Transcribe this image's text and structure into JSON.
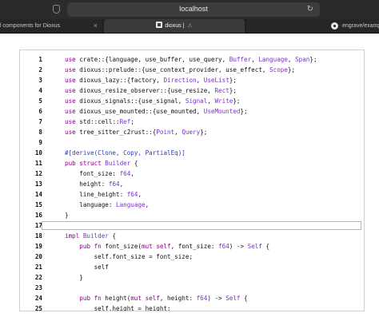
{
  "browser": {
    "url": "localhost",
    "tabs": [
      {
        "label": "l components for Dioxus",
        "close": "×"
      },
      {
        "label": "dioxus | ",
        "warning": "⚠"
      },
      {
        "label": "engrave/example"
      }
    ]
  },
  "editor": {
    "lines": [
      {
        "n": "1",
        "tokens": [
          [
            "kw",
            "use"
          ],
          [
            "",
            "crate::{language, use_buffer, use_query, "
          ],
          [
            "ty",
            "Buffer"
          ],
          [
            "",
            ", "
          ],
          [
            "ty",
            "Language"
          ],
          [
            "",
            ", "
          ],
          [
            "ty",
            "Span"
          ],
          [
            "",
            "};"
          ]
        ]
      },
      {
        "n": "2",
        "tokens": [
          [
            "kw",
            "use"
          ],
          [
            "",
            "dioxus::prelude::{use_context_provider, use_effect, "
          ],
          [
            "ty",
            "Scope"
          ],
          [
            "",
            "};"
          ]
        ]
      },
      {
        "n": "3",
        "tokens": [
          [
            "kw",
            "use"
          ],
          [
            "",
            "dioxus_lazy::{factory, "
          ],
          [
            "ty",
            "Direction"
          ],
          [
            "",
            ", "
          ],
          [
            "ty",
            "UseList"
          ],
          [
            "",
            "};"
          ]
        ]
      },
      {
        "n": "4",
        "tokens": [
          [
            "kw",
            "use"
          ],
          [
            "",
            "dioxus_resize_observer::{use_resize, "
          ],
          [
            "ty",
            "Rect"
          ],
          [
            "",
            "};"
          ]
        ]
      },
      {
        "n": "5",
        "tokens": [
          [
            "kw",
            "use"
          ],
          [
            "",
            "dioxus_signals::{use_signal, "
          ],
          [
            "ty",
            "Signal"
          ],
          [
            "",
            ", "
          ],
          [
            "ty",
            "Write"
          ],
          [
            "",
            "};"
          ]
        ]
      },
      {
        "n": "6",
        "tokens": [
          [
            "kw",
            "use"
          ],
          [
            "",
            "dioxus_use_mounted::{use_mounted, "
          ],
          [
            "ty",
            "UseMounted"
          ],
          [
            "",
            "};"
          ]
        ]
      },
      {
        "n": "7",
        "tokens": [
          [
            "kw",
            "use"
          ],
          [
            "",
            "std::cell::"
          ],
          [
            "ty",
            "Ref"
          ],
          [
            "",
            ";"
          ]
        ]
      },
      {
        "n": "8",
        "tokens": [
          [
            "kw",
            "use"
          ],
          [
            "",
            "tree_sitter_c2rust::{"
          ],
          [
            "ty",
            "Point"
          ],
          [
            "",
            ", "
          ],
          [
            "ty",
            "Query"
          ],
          [
            "",
            "};"
          ]
        ]
      },
      {
        "n": "9",
        "tokens": []
      },
      {
        "n": "10",
        "tokens": [
          [
            "at",
            "#[derive(Clone, Copy, PartialEq)]"
          ]
        ]
      },
      {
        "n": "11",
        "tokens": [
          [
            "kw",
            "pub struct"
          ],
          [
            "",
            ""
          ],
          [
            "ty",
            "Builder"
          ],
          [
            "",
            " {"
          ]
        ]
      },
      {
        "n": "12",
        "tokens": [
          [
            "",
            "    font_size: "
          ],
          [
            "num",
            "f64"
          ],
          [
            "",
            ","
          ]
        ]
      },
      {
        "n": "13",
        "tokens": [
          [
            "",
            "    height: "
          ],
          [
            "num",
            "f64"
          ],
          [
            "",
            ","
          ]
        ]
      },
      {
        "n": "14",
        "tokens": [
          [
            "",
            "    line_height: "
          ],
          [
            "num",
            "f64"
          ],
          [
            "",
            ","
          ]
        ]
      },
      {
        "n": "15",
        "tokens": [
          [
            "",
            "    language: "
          ],
          [
            "ty",
            "Language"
          ],
          [
            "",
            ","
          ]
        ]
      },
      {
        "n": "16",
        "tokens": [
          [
            "",
            "}"
          ]
        ]
      },
      {
        "n": "17",
        "tokens": []
      },
      {
        "n": "18",
        "tokens": [
          [
            "kw",
            "impl"
          ],
          [
            "",
            ""
          ],
          [
            "ty",
            "Builder"
          ],
          [
            "",
            " {"
          ]
        ]
      },
      {
        "n": "19",
        "tokens": [
          [
            "",
            "    "
          ],
          [
            "kw",
            "pub fn"
          ],
          [
            "",
            " font_size("
          ],
          [
            "kw",
            "mut self"
          ],
          [
            "",
            ", font_size: "
          ],
          [
            "num",
            "f64"
          ],
          [
            "",
            ") -> "
          ],
          [
            "ty",
            "Self"
          ],
          [
            "",
            " {"
          ]
        ]
      },
      {
        "n": "20",
        "tokens": [
          [
            "",
            "        self.font_size = font_size;"
          ]
        ]
      },
      {
        "n": "21",
        "tokens": [
          [
            "",
            "        self"
          ]
        ]
      },
      {
        "n": "22",
        "tokens": [
          [
            "",
            "    }"
          ]
        ]
      },
      {
        "n": "23",
        "tokens": []
      },
      {
        "n": "24",
        "tokens": [
          [
            "",
            "    "
          ],
          [
            "kw",
            "pub fn"
          ],
          [
            "",
            " height("
          ],
          [
            "kw",
            "mut self"
          ],
          [
            "",
            ", height: "
          ],
          [
            "num",
            "f64"
          ],
          [
            "",
            ") -> "
          ],
          [
            "ty",
            "Self"
          ],
          [
            "",
            " {"
          ]
        ]
      },
      {
        "n": "25",
        "tokens": [
          [
            "",
            "        self.height = height;"
          ]
        ]
      }
    ],
    "active_line": "17"
  }
}
